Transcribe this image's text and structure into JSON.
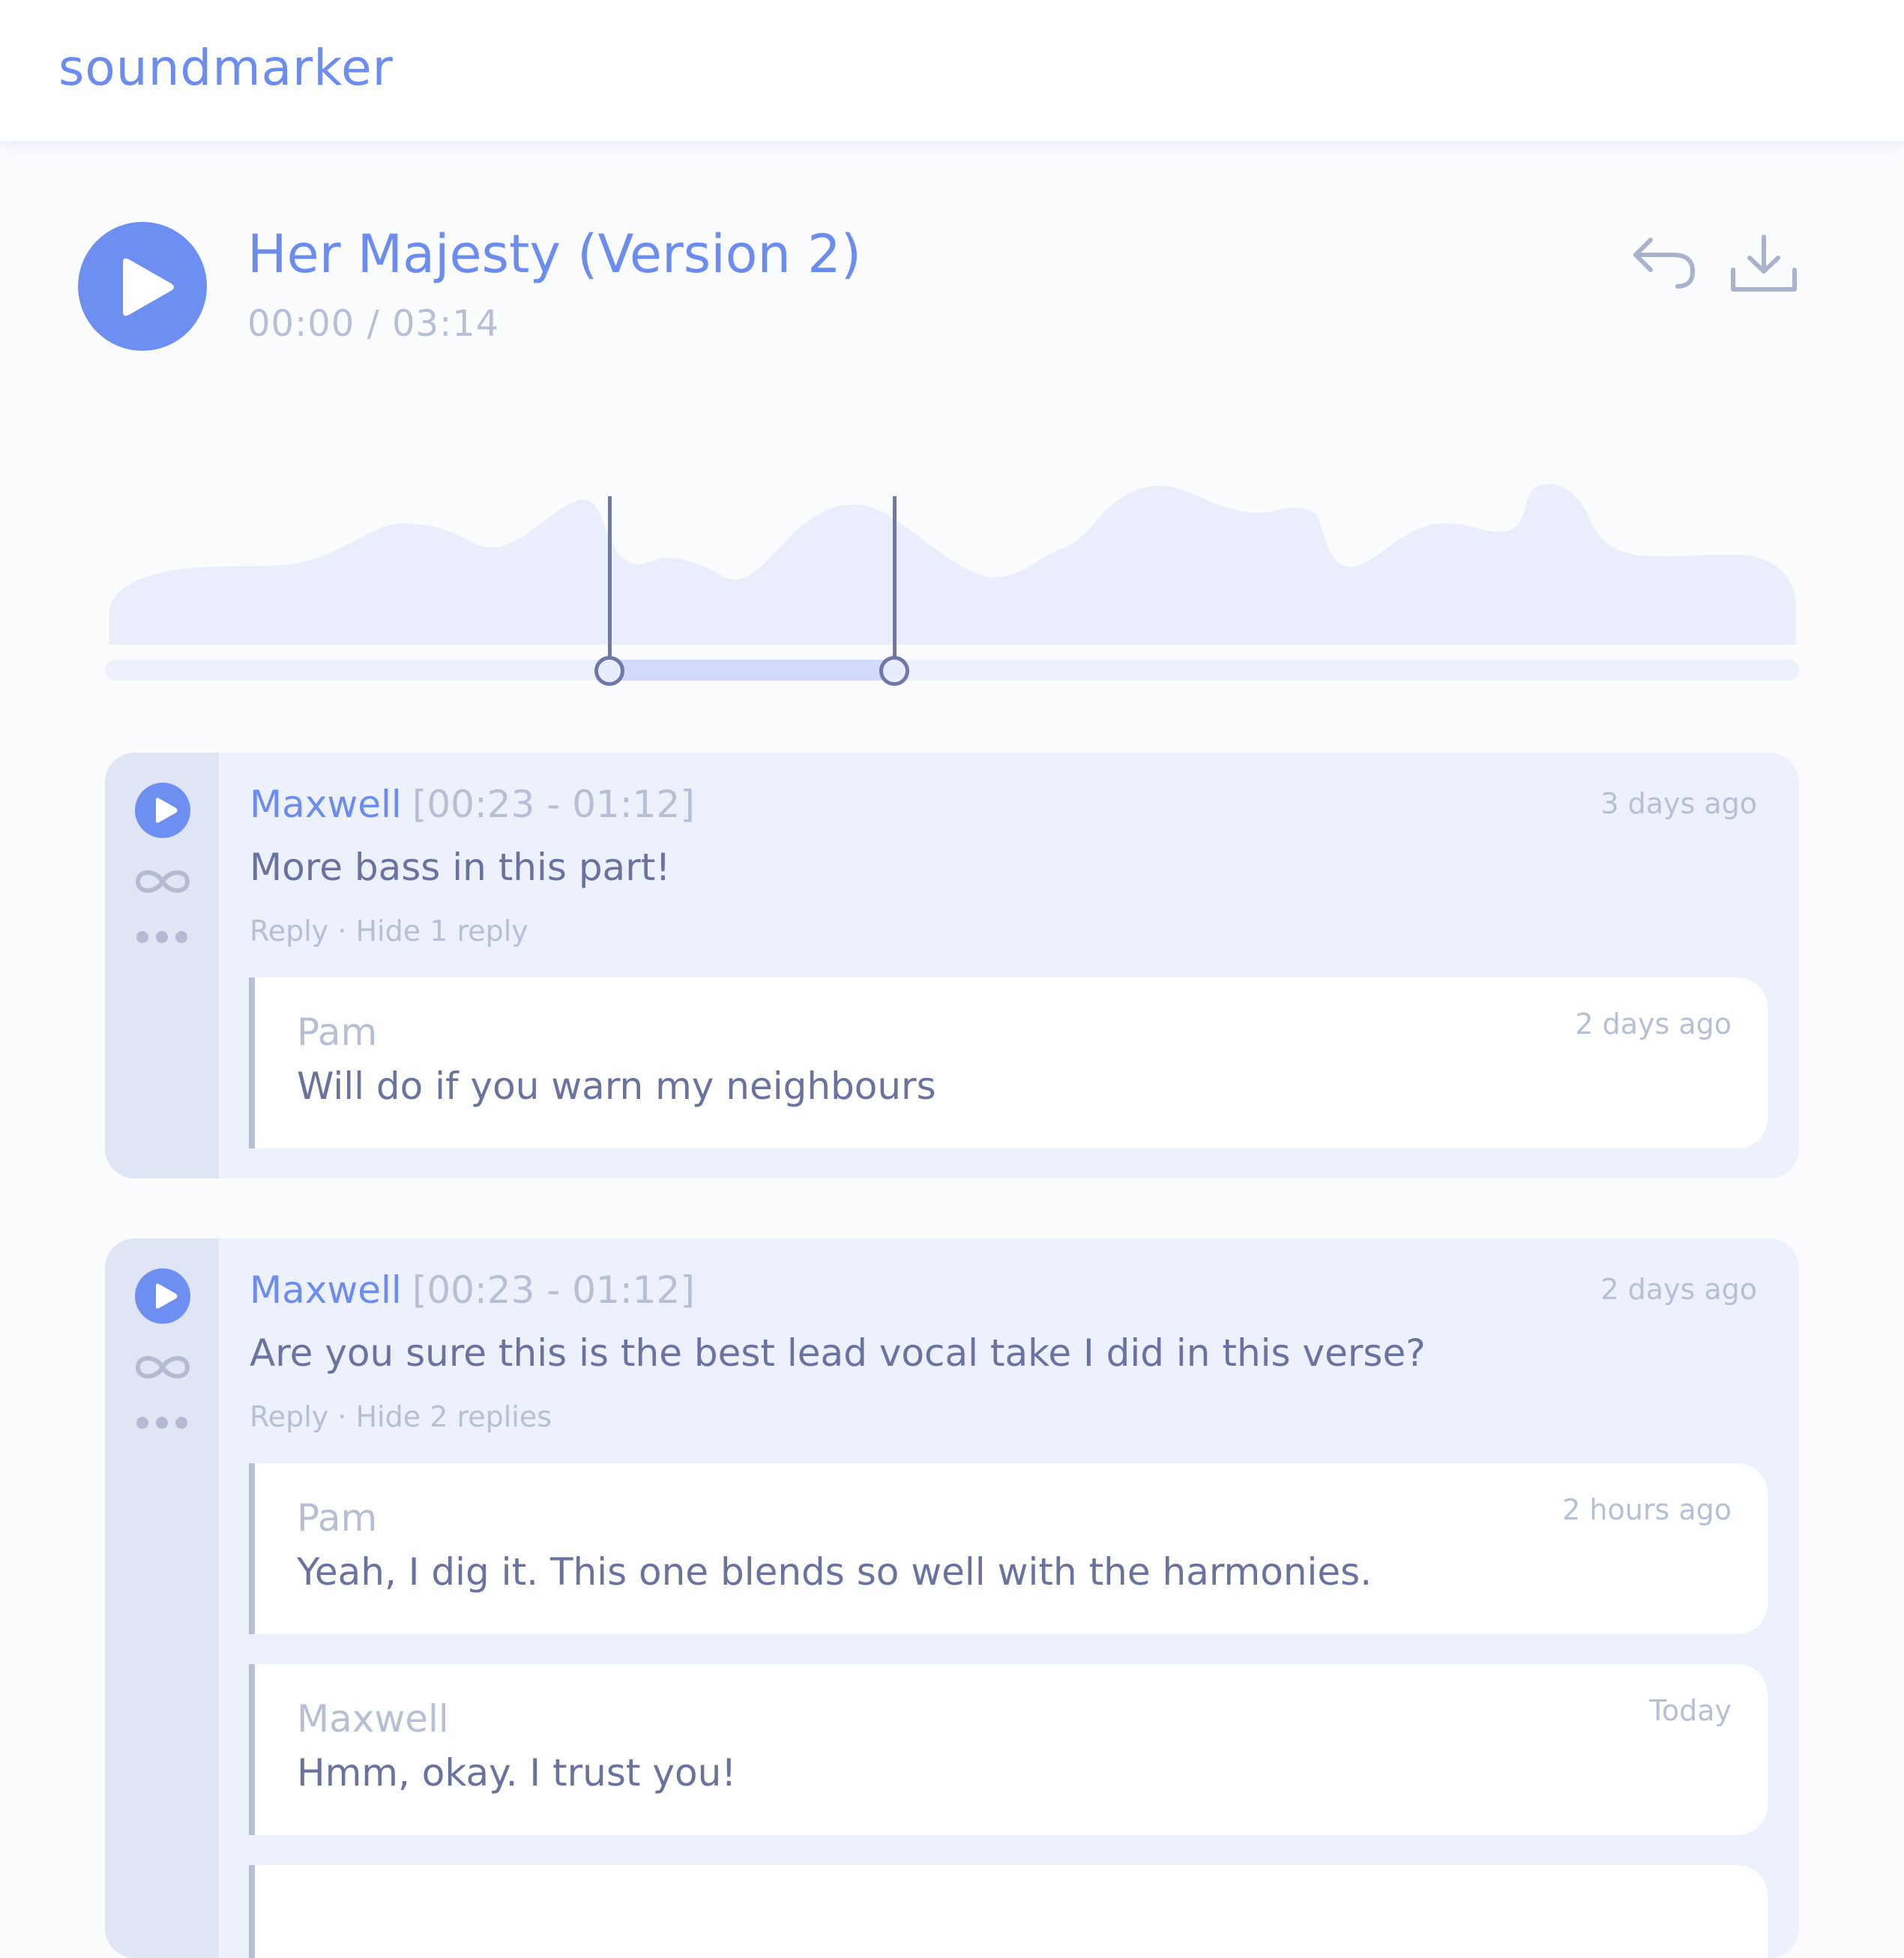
{
  "app": {
    "name": "soundmarker"
  },
  "player": {
    "title": "Her Majesty (Version 2)",
    "time": "00:00 / 03:14",
    "icons": {
      "play": "play-icon",
      "reply": "reply-icon",
      "download": "download-icon"
    }
  },
  "selection": {
    "start": "00:23",
    "end": "01:12",
    "duration": "03:14"
  },
  "comments": [
    {
      "author": "Maxwell",
      "range": "[00:23 - 01:12]",
      "time": "3 days ago",
      "text": "More bass in this part!",
      "actions": "Reply · Hide 1 reply",
      "replies": [
        {
          "author": "Pam",
          "time": "2 days ago",
          "text": "Will do if you warn my neighbours"
        }
      ]
    },
    {
      "author": "Maxwell",
      "range": "[00:23 - 01:12]",
      "time": "2 days ago",
      "text": "Are you sure this is the best lead vocal take I did in this verse?",
      "actions": "Reply · Hide 2 replies",
      "replies": [
        {
          "author": "Pam",
          "time": "2 hours ago",
          "text": "Yeah, I dig it. This one blends so well with the harmonies."
        },
        {
          "author": "Maxwell",
          "time": "Today",
          "text": "Hmm, okay. I trust you!"
        }
      ]
    }
  ],
  "colors": {
    "accent": "#6e8ff2",
    "text": "#6a72a0",
    "muted": "#b8bfd4",
    "card": "#edf1fc",
    "wave_played": "#d2dafa",
    "wave_unplayed": "#e8edfb"
  }
}
